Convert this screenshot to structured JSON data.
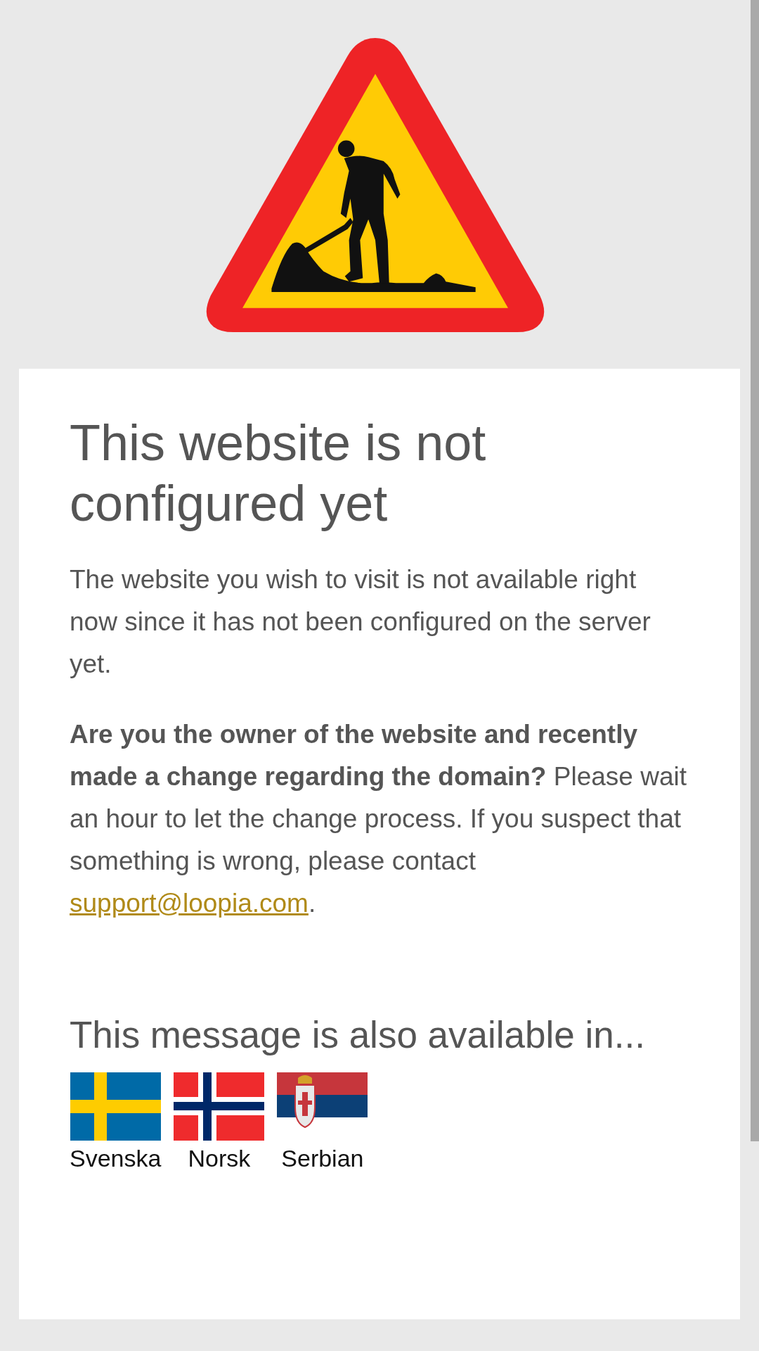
{
  "heading": "This website is not configured yet",
  "intro": "The website you wish to visit is not available right now since it has not been configured on the server yet.",
  "owner_note": {
    "text": "**Are you the owner of the website and recently made a change regarding the domain?** Please wait an hour to let the change process. If you suspect that something is wrong, please contact ",
    "email": "support@loopia.com",
    "after": "."
  },
  "languages_heading": "This message is also available in...",
  "languages": [
    {
      "kind": "sweden",
      "label": "Svenska"
    },
    {
      "kind": "norway",
      "label": "Norsk"
    },
    {
      "kind": "serbia",
      "label": "Serbian"
    }
  ]
}
